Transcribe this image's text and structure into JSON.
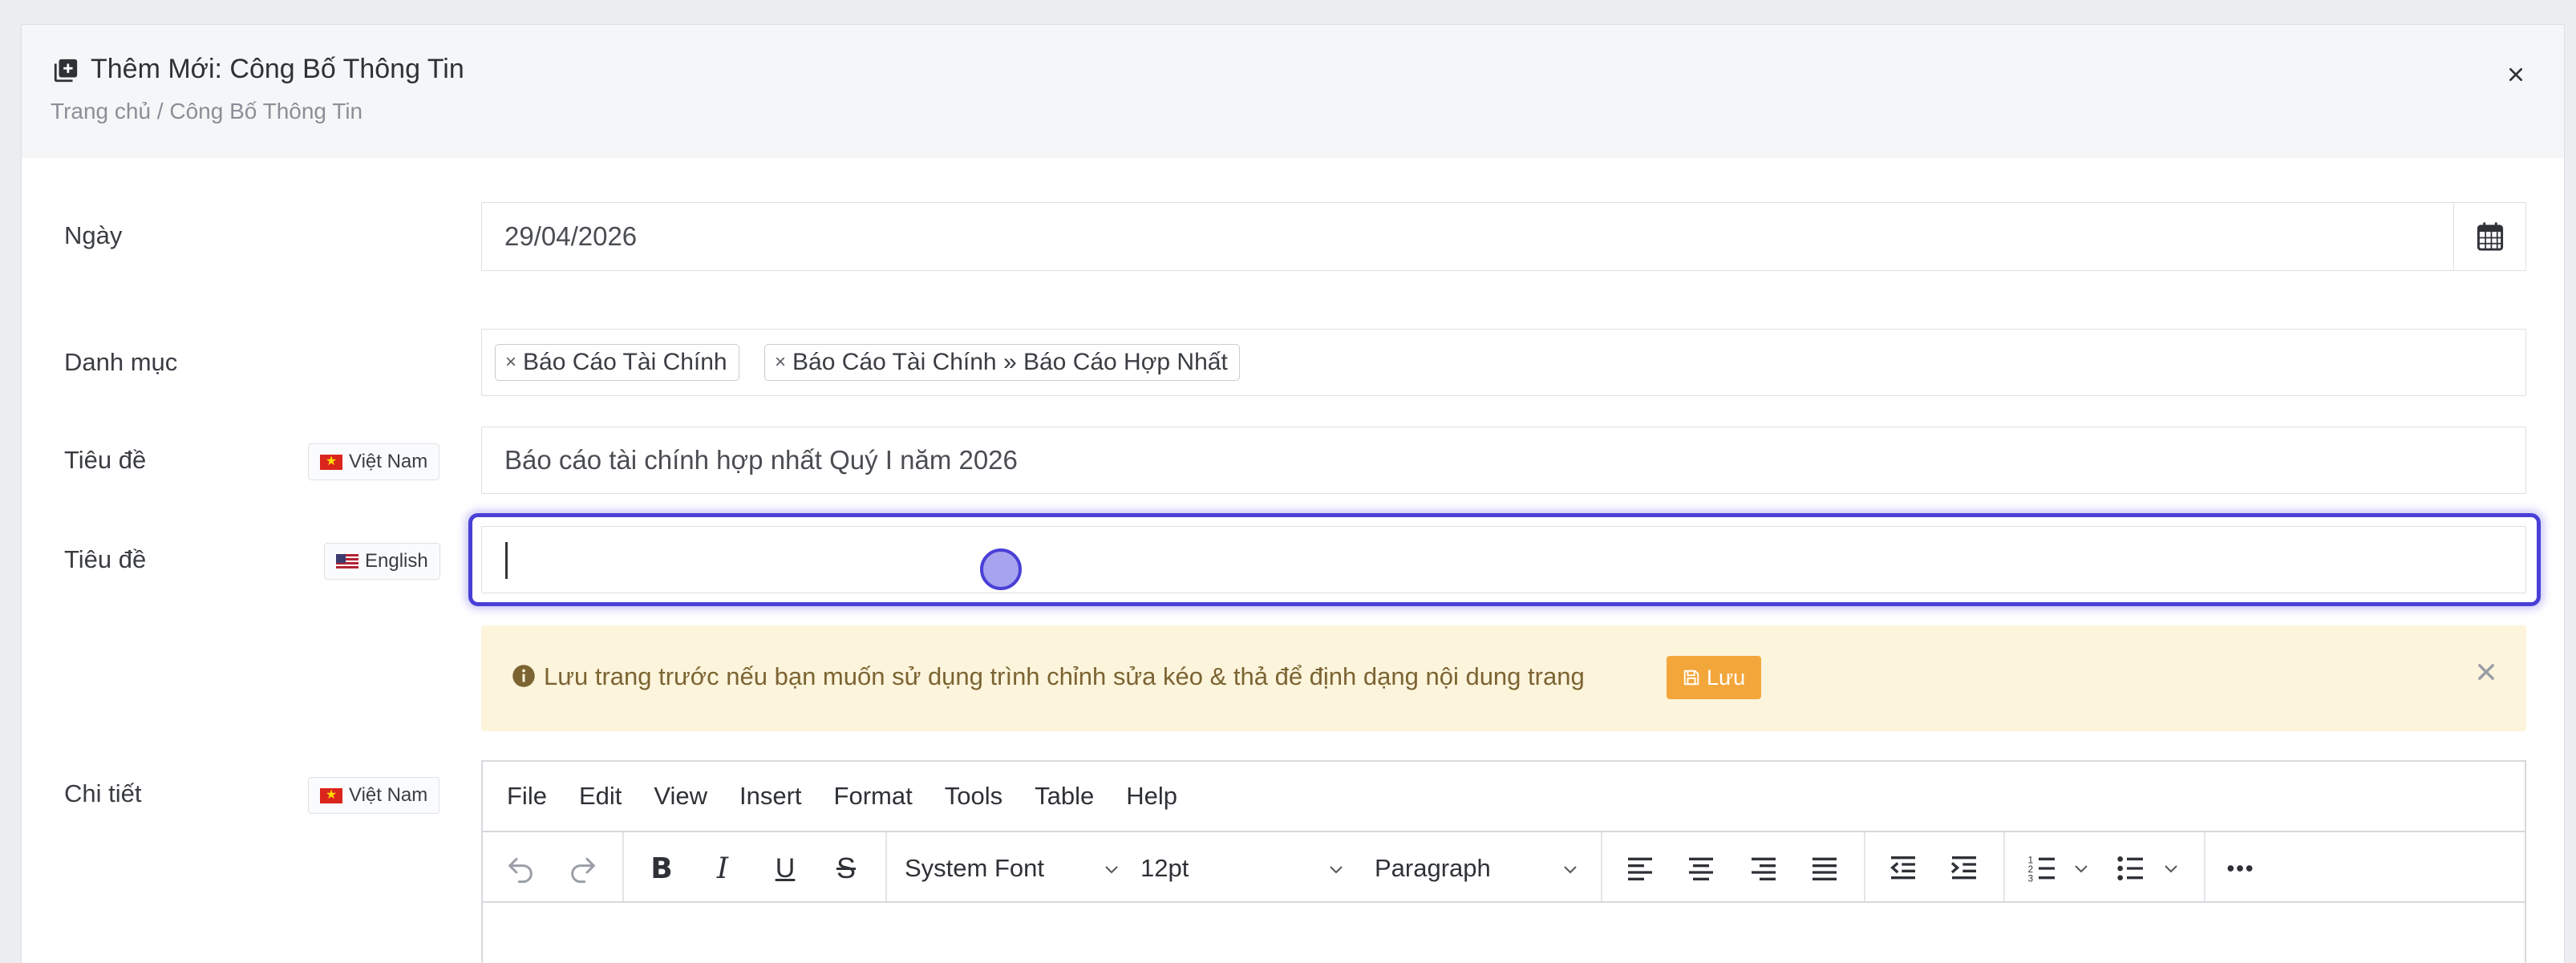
{
  "header": {
    "title": "Thêm Mới: Công Bố Thông Tin",
    "breadcrumb": "Trang chủ / Công Bố Thông Tin"
  },
  "form": {
    "date": {
      "label": "Ngày",
      "value": "29/04/2026"
    },
    "category": {
      "label": "Danh mục",
      "tags": [
        "Báo Cáo Tài Chính",
        "Báo Cáo Tài Chính » Báo Cáo Hợp Nhất"
      ]
    },
    "title_vi": {
      "label": "Tiêu đề",
      "lang": "Việt Nam",
      "value": "Báo cáo tài chính hợp nhất Quý I năm 2026"
    },
    "title_en": {
      "label": "Tiêu đề",
      "lang": "English",
      "value": ""
    },
    "detail": {
      "label": "Chi tiết",
      "lang": "Việt Nam"
    }
  },
  "alert": {
    "text": "Lưu trang trước nếu bạn muốn sử dụng trình chỉnh sửa kéo & thả để định dạng nội dung trang",
    "button": "Lưu"
  },
  "editor": {
    "menu": [
      "File",
      "Edit",
      "View",
      "Insert",
      "Format",
      "Tools",
      "Table",
      "Help"
    ],
    "font_family": "System Font",
    "font_size": "12pt",
    "block_format": "Paragraph"
  },
  "colors": {
    "focus_ring": "#4a3fd6",
    "alert_bg": "#fdf4dc",
    "save_button": "#f3a73b"
  }
}
